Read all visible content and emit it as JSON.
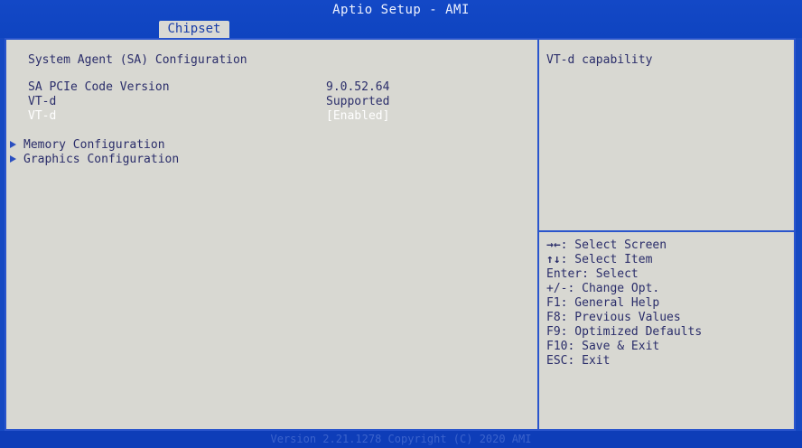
{
  "header": {
    "title": "Aptio Setup - AMI",
    "tabs": [
      {
        "label": "Chipset",
        "active": true
      }
    ]
  },
  "main": {
    "section_title": "System Agent (SA) Configuration",
    "rows": [
      {
        "label": "SA PCIe Code Version",
        "value": "9.0.52.64"
      },
      {
        "label": "VT-d",
        "value": "Supported"
      },
      {
        "label": "VT-d",
        "value": "[Enabled]",
        "selected": true
      }
    ],
    "submenus": [
      {
        "label": "Memory Configuration"
      },
      {
        "label": "Graphics Configuration"
      }
    ]
  },
  "help": {
    "description": "VT-d capability",
    "keys": [
      {
        "icon": "left-right-arrows-icon",
        "key": "→←",
        "text": ": Select Screen"
      },
      {
        "icon": "up-down-arrows-icon",
        "key": "↑↓",
        "text": ": Select Item"
      },
      {
        "icon": "",
        "key": "Enter",
        "text": ": Select"
      },
      {
        "icon": "",
        "key": "+/-",
        "text": ": Change Opt."
      },
      {
        "icon": "",
        "key": "F1",
        "text": ": General Help"
      },
      {
        "icon": "",
        "key": "F8",
        "text": ": Previous Values"
      },
      {
        "icon": "",
        "key": "F9",
        "text": ": Optimized Defaults"
      },
      {
        "icon": "",
        "key": "F10",
        "text": ": Save & Exit"
      },
      {
        "icon": "",
        "key": "ESC",
        "text": ": Exit"
      }
    ]
  },
  "footer": {
    "version": "Version 2.21.1278 Copyright (C) 2020 AMI"
  },
  "colors": {
    "background": "#1649c2",
    "panel": "#d8d8d2",
    "text": "#2a2d6a",
    "highlight": "#ffffff",
    "border": "#2a55cc"
  }
}
